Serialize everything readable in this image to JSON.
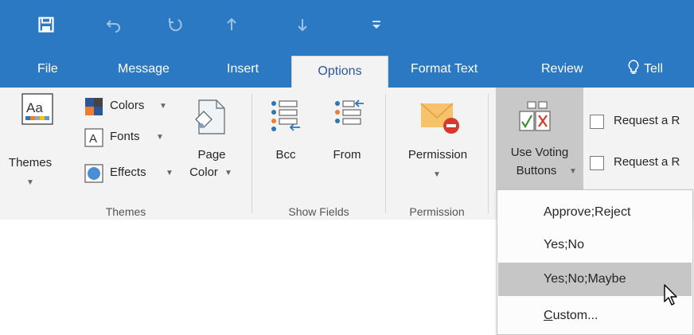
{
  "quick_access": {
    "buttons": [
      "save-icon",
      "undo-icon",
      "redo-icon",
      "up-arrow-icon",
      "down-arrow-icon",
      "customize-icon"
    ]
  },
  "tabs": {
    "file": "File",
    "message": "Message",
    "insert": "Insert",
    "options": "Options",
    "format_text": "Format Text",
    "review": "Review",
    "tell": "Tell"
  },
  "ribbon": {
    "themes_group": {
      "themes_label": "Themes",
      "colors_label": "Colors",
      "fonts_label": "Fonts",
      "effects_label": "Effects",
      "page_color_line1": "Page",
      "page_color_line2": "Color",
      "group_label": "Themes"
    },
    "show_fields_group": {
      "bcc_label": "Bcc",
      "from_label": "From",
      "group_label": "Show Fields"
    },
    "permission_group": {
      "permission_label": "Permission",
      "group_label": "Permission"
    },
    "tracking_group": {
      "voting_line1": "Use Voting",
      "voting_line2": "Buttons",
      "request_1": "Request a R",
      "request_2": "Request a R"
    }
  },
  "voting_menu": {
    "items": [
      "Approve;Reject",
      "Yes;No",
      "Yes;No;Maybe",
      "Custom..."
    ],
    "highlighted": "Yes;No;Maybe"
  },
  "colors": {
    "title_bar": "#2b79c2",
    "ribbon_bg": "#f3f3f3",
    "active_tab_text": "#2b579a",
    "menu_highlight": "#c6c6c6"
  }
}
